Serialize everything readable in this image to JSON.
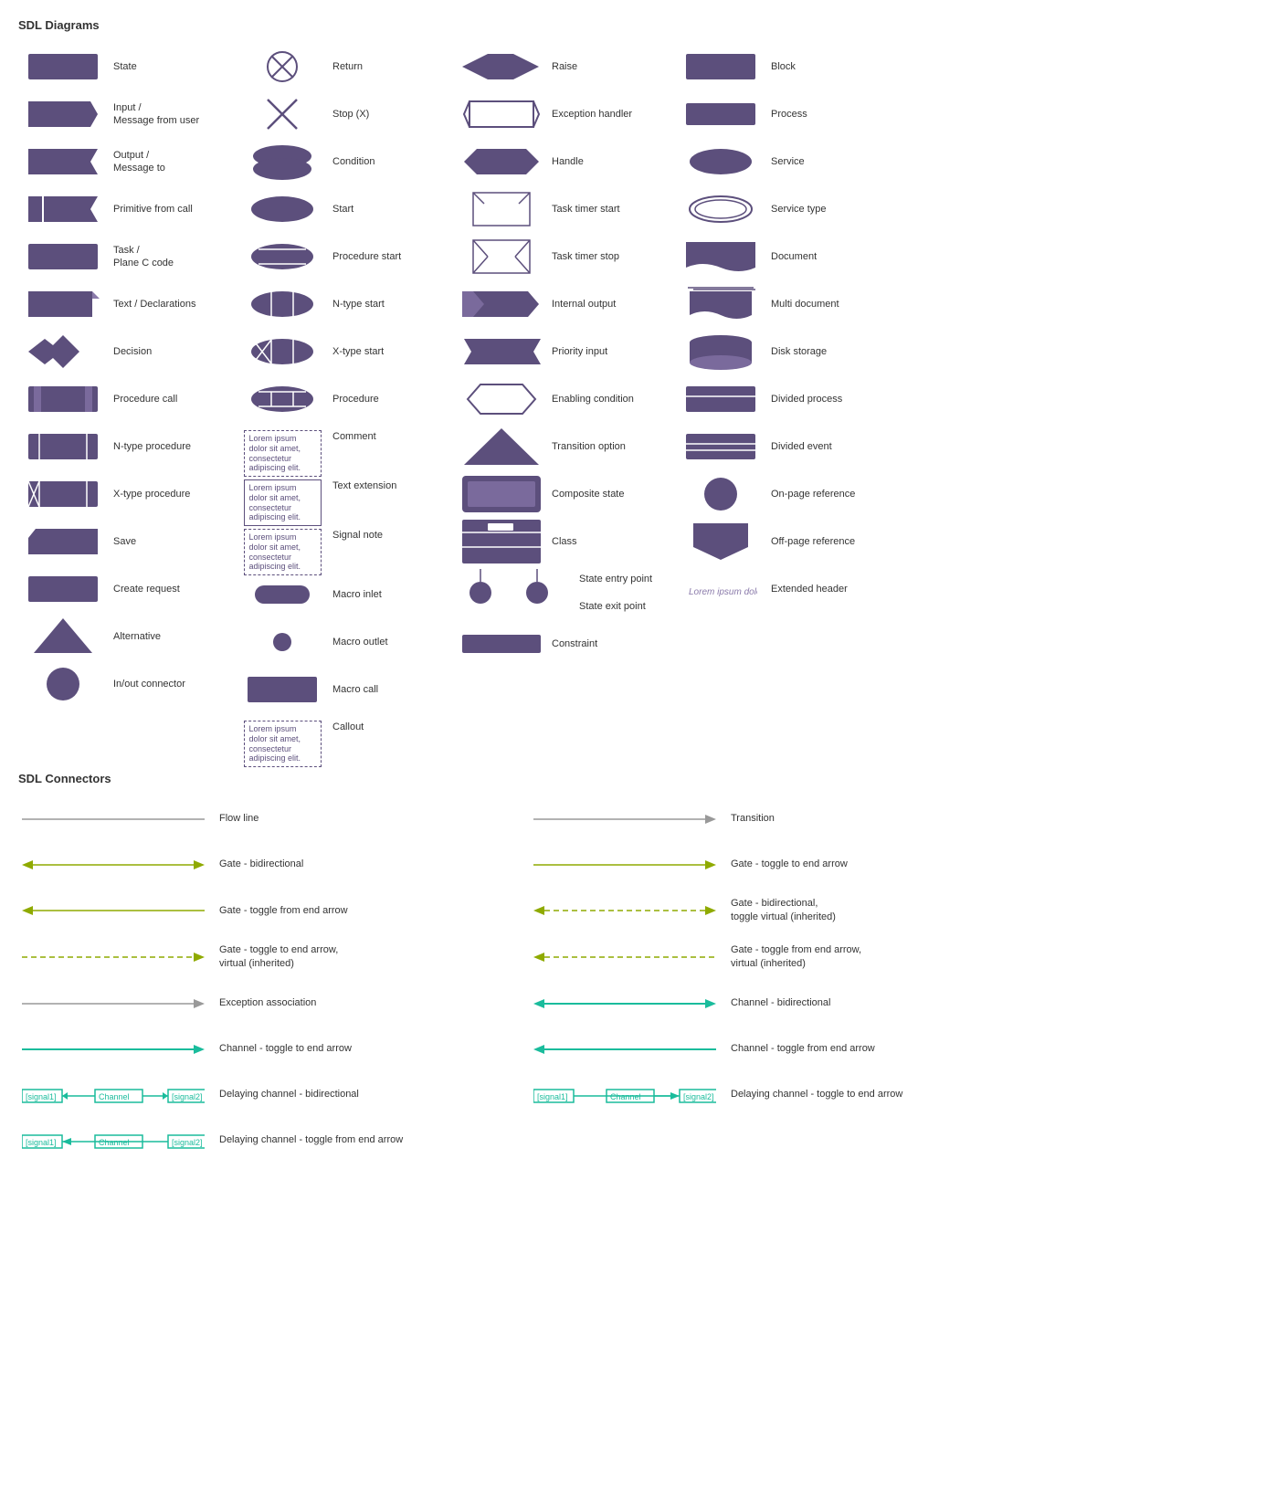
{
  "sdl_diagrams_title": "SDL Diagrams",
  "sdl_connectors_title": "SDL Connectors",
  "shapes": [
    {
      "id": "state",
      "label": "State",
      "col": 0
    },
    {
      "id": "input",
      "label": "Input /\nMessage from user",
      "col": 0
    },
    {
      "id": "output",
      "label": "Output /\nMessage to",
      "col": 0
    },
    {
      "id": "primitive",
      "label": "Primitive from call",
      "col": 0
    },
    {
      "id": "task",
      "label": "Task /\nPlane C code",
      "col": 0
    },
    {
      "id": "text",
      "label": "Text / Declarations",
      "col": 0
    },
    {
      "id": "decision",
      "label": "Decision",
      "col": 0
    },
    {
      "id": "procedure_call",
      "label": "Procedure call",
      "col": 0
    },
    {
      "id": "ntype_proc",
      "label": "N-type procedure",
      "col": 0
    },
    {
      "id": "xtype_proc",
      "label": "X-type procedure",
      "col": 0
    },
    {
      "id": "save",
      "label": "Save",
      "col": 0
    },
    {
      "id": "create_request",
      "label": "Create request",
      "col": 0
    },
    {
      "id": "alternative",
      "label": "Alternative",
      "col": 0
    },
    {
      "id": "inout_connector",
      "label": "In/out connector",
      "col": 0
    },
    {
      "id": "return",
      "label": "Return",
      "col": 1
    },
    {
      "id": "stop",
      "label": "Stop (X)",
      "col": 1
    },
    {
      "id": "condition",
      "label": "Condition",
      "col": 1
    },
    {
      "id": "start",
      "label": "Start",
      "col": 1
    },
    {
      "id": "procedure_start",
      "label": "Procedure start",
      "col": 1
    },
    {
      "id": "ntype_start",
      "label": "N-type start",
      "col": 1
    },
    {
      "id": "xtype_start",
      "label": "X-type start",
      "col": 1
    },
    {
      "id": "procedure",
      "label": "Procedure",
      "col": 1
    },
    {
      "id": "comment",
      "label": "Comment",
      "col": 1
    },
    {
      "id": "text_extension",
      "label": "Text extension",
      "col": 1
    },
    {
      "id": "signal_note",
      "label": "Signal note",
      "col": 1
    },
    {
      "id": "macro_inlet",
      "label": "Macro inlet",
      "col": 1
    },
    {
      "id": "macro_outlet",
      "label": "Macro outlet",
      "col": 1
    },
    {
      "id": "macro_call",
      "label": "Macro call",
      "col": 1
    },
    {
      "id": "callout",
      "label": "Callout",
      "col": 1
    },
    {
      "id": "raise",
      "label": "Raise",
      "col": 2
    },
    {
      "id": "exception_handler",
      "label": "Exception handler",
      "col": 2
    },
    {
      "id": "handle",
      "label": "Handle",
      "col": 2
    },
    {
      "id": "task_timer_start",
      "label": "Task timer start",
      "col": 2
    },
    {
      "id": "task_timer_stop",
      "label": "Task timer stop",
      "col": 2
    },
    {
      "id": "internal_output",
      "label": "Internal output",
      "col": 2
    },
    {
      "id": "priority_input",
      "label": "Priority input",
      "col": 2
    },
    {
      "id": "enabling_condition",
      "label": "Enabling condition",
      "col": 2
    },
    {
      "id": "transition_option",
      "label": "Transition option",
      "col": 2
    },
    {
      "id": "composite_state",
      "label": "Composite state",
      "col": 2
    },
    {
      "id": "class",
      "label": "Class",
      "col": 2
    },
    {
      "id": "state_entry",
      "label": "State entry point",
      "col": 2
    },
    {
      "id": "state_exit",
      "label": "State exit point",
      "col": 2
    },
    {
      "id": "constraint",
      "label": "Constraint",
      "col": 2
    },
    {
      "id": "block",
      "label": "Block",
      "col": 3
    },
    {
      "id": "process",
      "label": "Process",
      "col": 3
    },
    {
      "id": "service",
      "label": "Service",
      "col": 3
    },
    {
      "id": "service_type",
      "label": "Service type",
      "col": 3
    },
    {
      "id": "document",
      "label": "Document",
      "col": 3
    },
    {
      "id": "multi_document",
      "label": "Multi document",
      "col": 3
    },
    {
      "id": "disk_storage",
      "label": "Disk storage",
      "col": 3
    },
    {
      "id": "divided_process",
      "label": "Divided process",
      "col": 3
    },
    {
      "id": "divided_event",
      "label": "Divided event",
      "col": 3
    },
    {
      "id": "on_page",
      "label": "On-page reference",
      "col": 3
    },
    {
      "id": "off_page",
      "label": "Off-page reference",
      "col": 3
    },
    {
      "id": "extended_header",
      "label": "Extended header",
      "col": 3
    }
  ],
  "connectors": [
    {
      "id": "flow_line",
      "label": "Flow line",
      "type": "flow"
    },
    {
      "id": "transition",
      "label": "Transition",
      "type": "transition"
    },
    {
      "id": "gate_bidi",
      "label": "Gate - bidirectional",
      "type": "gate_bidi"
    },
    {
      "id": "gate_toggle_end",
      "label": "Gate - toggle to end arrow",
      "type": "gate_toggle_end"
    },
    {
      "id": "gate_toggle_from",
      "label": "Gate - toggle from end arrow",
      "type": "gate_toggle_from"
    },
    {
      "id": "gate_bidi_virtual",
      "label": "Gate - bidirectional,\ntoggle virtual (inherited)",
      "type": "gate_bidi_virtual"
    },
    {
      "id": "gate_toggle_end_virtual",
      "label": "Gate - toggle to end arrow,\nvirtual (inherited)",
      "type": "gate_toggle_end_virtual"
    },
    {
      "id": "gate_toggle_from_virtual",
      "label": "Gate - toggle from end arrow,\nvirtual (inherited)",
      "type": "gate_toggle_from_virtual"
    },
    {
      "id": "exception_assoc",
      "label": "Exception association",
      "type": "exception_assoc"
    },
    {
      "id": "channel_bidi",
      "label": "Channel - bidirectional",
      "type": "channel_bidi"
    },
    {
      "id": "channel_toggle_end",
      "label": "Channel - toggle to end arrow",
      "type": "channel_toggle_end"
    },
    {
      "id": "channel_toggle_from",
      "label": "Channel - toggle from end arrow",
      "type": "channel_toggle_from"
    },
    {
      "id": "delaying_bidi",
      "label": "Delaying channel - bidirectional",
      "type": "delaying_bidi"
    },
    {
      "id": "delaying_toggle_end",
      "label": "Delaying channel - toggle to end arrow",
      "type": "delaying_toggle_end"
    },
    {
      "id": "delaying_toggle_from",
      "label": "Delaying channel - toggle from end arrow",
      "type": "delaying_toggle_from"
    }
  ],
  "purple_color": "#5c4f7c",
  "teal_color": "#1abc9c",
  "olive_color": "#8faa00"
}
